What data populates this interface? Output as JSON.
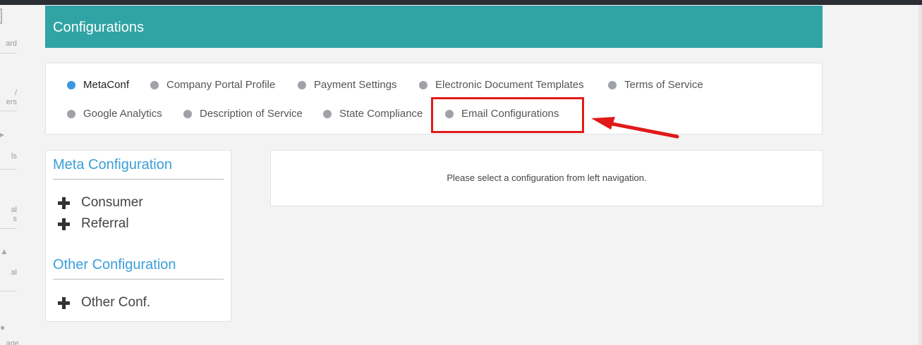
{
  "header": {
    "title": "Configurations"
  },
  "sidebar": {
    "items": [
      {
        "label": "ard"
      },
      {
        "label_line1": "/",
        "label_line2": "ers"
      },
      {
        "label": "ls"
      },
      {
        "label_line1": "al",
        "label_line2": "s"
      },
      {
        "label": "al"
      },
      {
        "label": "agent"
      }
    ]
  },
  "tabs": [
    {
      "label": "MetaConf",
      "active": true
    },
    {
      "label": "Company Portal Profile",
      "active": false
    },
    {
      "label": "Payment Settings",
      "active": false
    },
    {
      "label": "Electronic Document Templates",
      "active": false
    },
    {
      "label": "Terms of Service",
      "active": false
    },
    {
      "label": "Google Analytics",
      "active": false
    },
    {
      "label": "Description of Service",
      "active": false
    },
    {
      "label": "State Compliance",
      "active": false
    },
    {
      "label": "Email Configurations",
      "active": false
    }
  ],
  "annotation": {
    "highlight_color": "#e01a1a",
    "highlighted_tab": "Email Configurations"
  },
  "leftnav": {
    "meta_heading": "Meta Configuration",
    "meta_items": [
      "Consumer",
      "Referral"
    ],
    "other_heading": "Other Configuration",
    "other_items": [
      "Other Conf."
    ]
  },
  "content": {
    "message": "Please select a configuration from left navigation."
  },
  "colors": {
    "header_bg": "#30a3a4",
    "active_dot": "#3b97e0",
    "link_blue": "#3b9fd8"
  }
}
